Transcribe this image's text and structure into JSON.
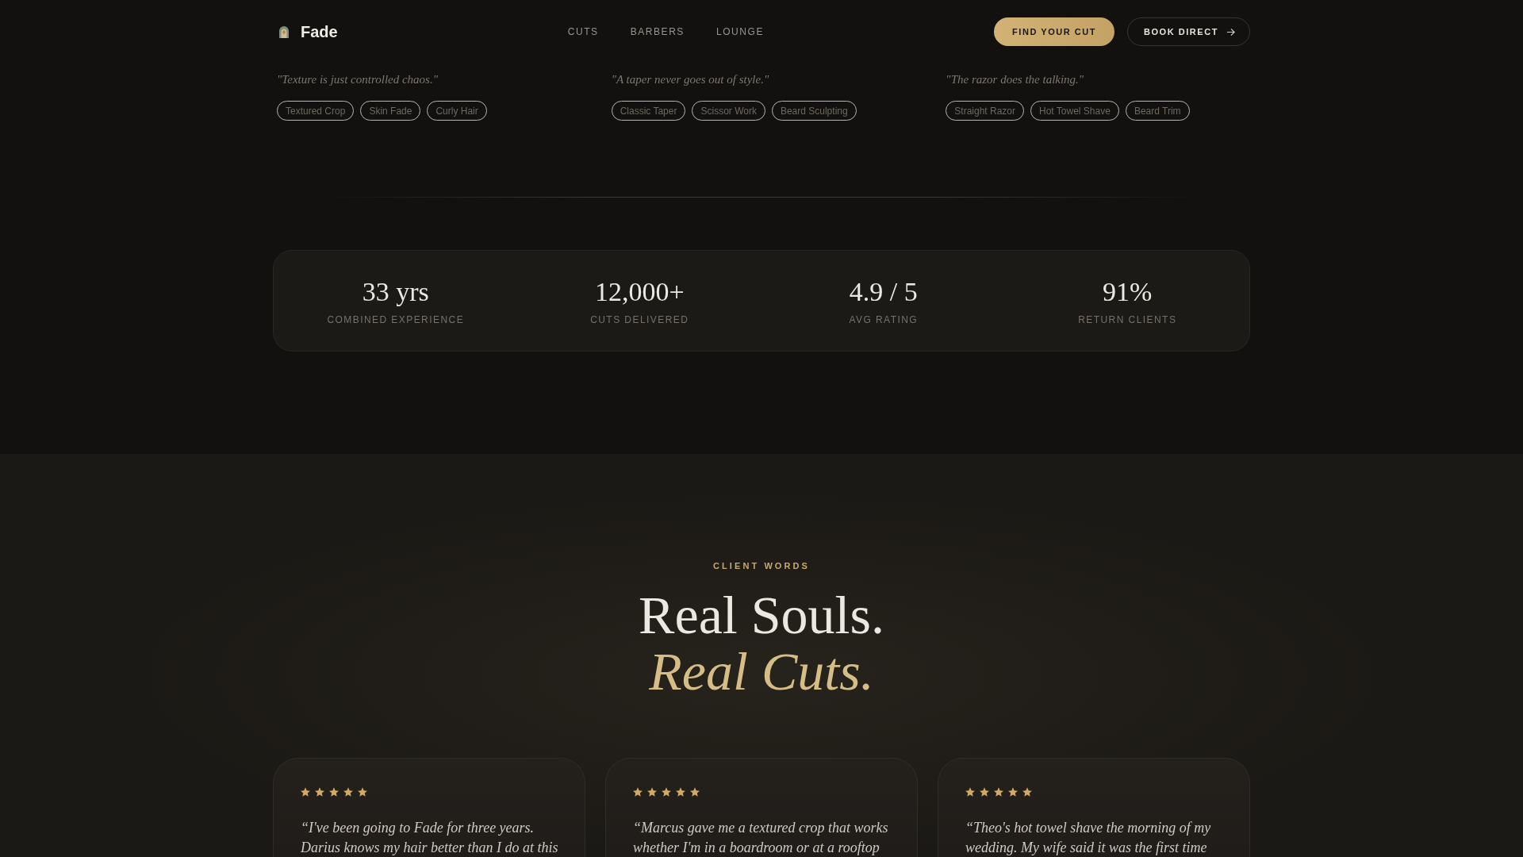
{
  "header": {
    "brand": "Fade",
    "nav": [
      {
        "label": "CUTS"
      },
      {
        "label": "BARBERS"
      },
      {
        "label": "LOUNGE"
      }
    ],
    "buttons": [
      {
        "label": "FIND YOUR CUT",
        "kind": "primary"
      },
      {
        "label": "BOOK DIRECT",
        "kind": "outline"
      }
    ]
  },
  "barbers": [
    {
      "quote": "\"Texture is just controlled chaos.\"",
      "tags": [
        "Textured Crop",
        "Skin Fade",
        "Curly Hair"
      ]
    },
    {
      "quote": "\"A taper never goes out of style.\"",
      "tags": [
        "Classic Taper",
        "Scissor Work",
        "Beard Sculpting"
      ]
    },
    {
      "quote": "\"The razor does the talking.\"",
      "tags": [
        "Straight Razor",
        "Hot Towel Shave",
        "Beard Trim"
      ]
    }
  ],
  "stats": [
    {
      "value": "33 yrs",
      "label": "COMBINED EXPERIENCE"
    },
    {
      "value": "12,000+",
      "label": "CUTS DELIVERED"
    },
    {
      "value": "4.9 / 5",
      "label": "AVG RATING"
    },
    {
      "value": "91%",
      "label": "RETURN CLIENTS"
    }
  ],
  "testimonials": {
    "eyebrow": "CLIENT WORDS",
    "heading": "Real Souls.",
    "heading_accent": "Real Cuts.",
    "items": [
      {
        "stars": 5,
        "text": "“I've been going to Fade for three years. Darius knows my hair better than I do at this"
      },
      {
        "stars": 5,
        "text": "“Marcus gave me a textured crop that works whether I'm in a boardroom or at a rooftop"
      },
      {
        "stars": 5,
        "text": "“Theo's hot towel shave the morning of my wedding. My wife said it was the first time"
      }
    ]
  }
}
